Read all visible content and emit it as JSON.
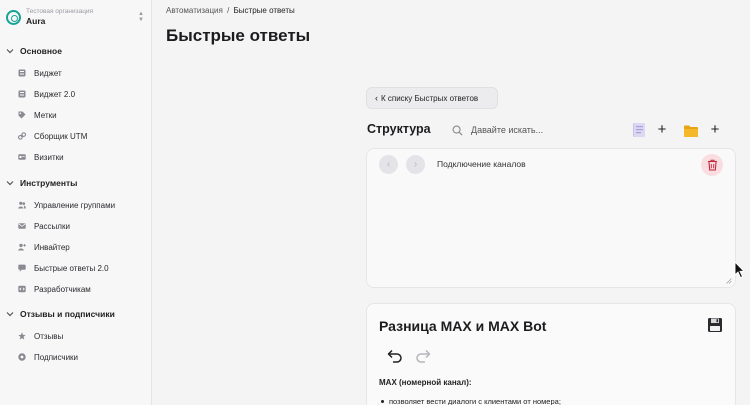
{
  "sidebar": {
    "org": {
      "subtitle": "Тестовая организация",
      "name": "Aura"
    },
    "sections": [
      {
        "label": "Основное",
        "items": [
          {
            "label": "Виджет",
            "icon": "widget-icon"
          },
          {
            "label": "Виджет 2.0",
            "icon": "widget-icon"
          },
          {
            "label": "Метки",
            "icon": "tag-icon"
          },
          {
            "label": "Сборщик UTM",
            "icon": "link-icon"
          },
          {
            "label": "Визитки",
            "icon": "card-icon"
          }
        ]
      },
      {
        "label": "Инструменты",
        "items": [
          {
            "label": "Управление группами",
            "icon": "users-icon"
          },
          {
            "label": "Рассылки",
            "icon": "mail-icon"
          },
          {
            "label": "Инвайтер",
            "icon": "user-plus-icon"
          },
          {
            "label": "Быстрые ответы 2.0",
            "icon": "chat-icon"
          },
          {
            "label": "Разработчикам",
            "icon": "code-icon"
          }
        ]
      },
      {
        "label": "Отзывы и подписчики",
        "items": [
          {
            "label": "Отзывы",
            "icon": "star-icon"
          },
          {
            "label": "Подписчики",
            "icon": "eye-icon"
          }
        ]
      }
    ]
  },
  "breadcrumb": {
    "parent": "Автоматизация",
    "separator": "/",
    "current": "Быстрые ответы"
  },
  "page": {
    "title": "Быстрые ответы"
  },
  "back_button": {
    "arrow": "‹",
    "label": "К списку Быстрых ответов"
  },
  "structure": {
    "label": "Структура",
    "search_placeholder": "Давайте искать...",
    "plus": "+",
    "prev": "‹",
    "next": "›",
    "current_node": "Подключение каналов"
  },
  "editor": {
    "title": "Разница MAX и MAX Bot",
    "content_heading": "MAX (номерной канал):",
    "content_bullet": "позволяет вести диалоги с клиентами от номера;"
  },
  "colors": {
    "accent": "#16a394",
    "danger_bg": "#f9dde0",
    "danger": "#c0283a",
    "folder": "#f5b82a"
  }
}
